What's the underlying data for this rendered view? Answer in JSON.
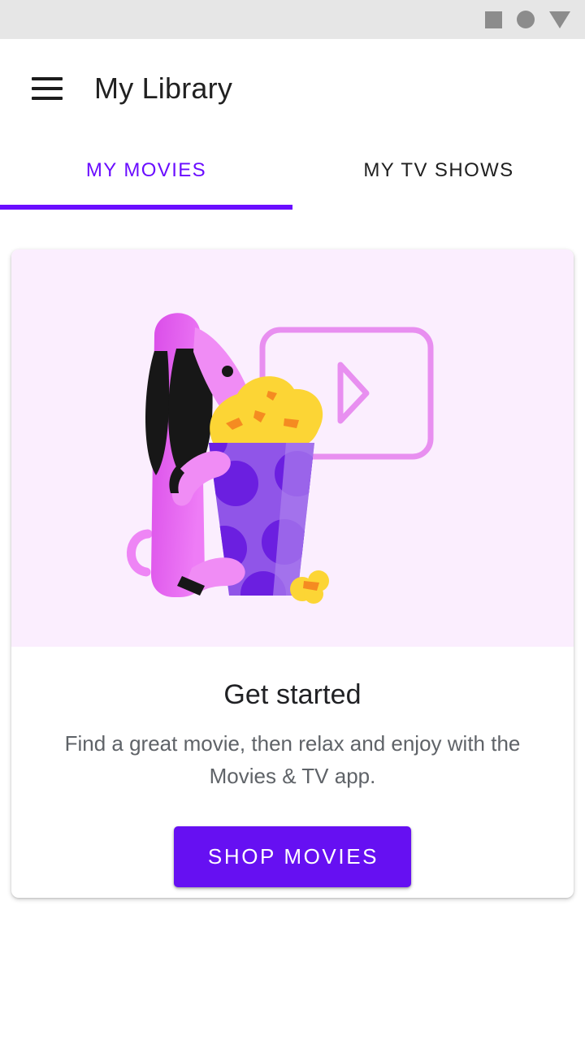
{
  "status_bar": {
    "icons": [
      {
        "name": "square-icon",
        "glyph": "square"
      },
      {
        "name": "circle-icon",
        "glyph": "circle"
      },
      {
        "name": "triangle-down-icon",
        "glyph": "triangle-down"
      }
    ],
    "background_color": "#E6E6E6",
    "icon_color": "#8C8C8C"
  },
  "app_bar": {
    "menu_icon": "hamburger-menu-icon",
    "title": "My Library",
    "title_color": "#212121"
  },
  "tabs": {
    "items": [
      {
        "label": "MY MOVIES",
        "active": true
      },
      {
        "label": "MY TV SHOWS",
        "active": false
      }
    ],
    "active_color": "#6A0DFF",
    "inactive_color": "#202020",
    "indicator_color": "#6A0DFF"
  },
  "card": {
    "illustration": {
      "name": "dog-with-popcorn-illustration",
      "background_color": "#FBEEFE",
      "dog_body_color": "#E05BEE",
      "dog_snout_color": "#F08CF5",
      "dog_ear_color": "#1A1A1A",
      "bucket_color": "#9055E8",
      "bucket_dot_color": "#6B1FE0",
      "popcorn_color": "#FCD535",
      "popcorn_accent_color": "#F58B21",
      "screen_outline_color": "#E88FF0"
    },
    "title": "Get started",
    "description": "Find a great movie, then relax and enjoy with the Movies & TV app.",
    "button_label": "SHOP MOVIES",
    "button_color": "#6610F2",
    "button_text_color": "#FFFFFF"
  }
}
